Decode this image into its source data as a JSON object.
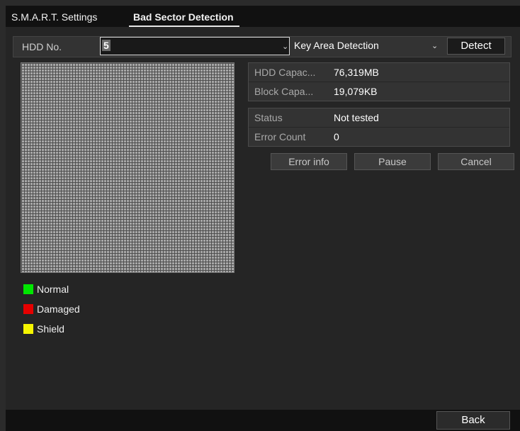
{
  "tabs": [
    {
      "label": "S.M.A.R.T. Settings",
      "active": false
    },
    {
      "label": "Bad Sector Detection",
      "active": true
    }
  ],
  "hdd": {
    "label": "HDD No.",
    "selected": "5",
    "mode_selected": "Key Area Detection",
    "detect_label": "Detect",
    "chevron_icon": "chevron-down-icon"
  },
  "capacity": [
    {
      "key": "HDD Capac...",
      "value": "76,319MB"
    },
    {
      "key": "Block Capa...",
      "value": "19,079KB"
    }
  ],
  "status": [
    {
      "key": "Status",
      "value": "Not tested"
    },
    {
      "key": "Error Count",
      "value": "0"
    }
  ],
  "actions": {
    "error_info": "Error info",
    "pause": "Pause",
    "cancel": "Cancel"
  },
  "legend": [
    {
      "label": "Normal",
      "color": "#00e600"
    },
    {
      "label": "Damaged",
      "color": "#e60000"
    },
    {
      "label": "Shield",
      "color": "#f5f500"
    }
  ],
  "colors": {
    "grid_cell": "#a7a7a7",
    "grid_line": "#4e4e4e"
  },
  "footer": {
    "back_label": "Back"
  }
}
